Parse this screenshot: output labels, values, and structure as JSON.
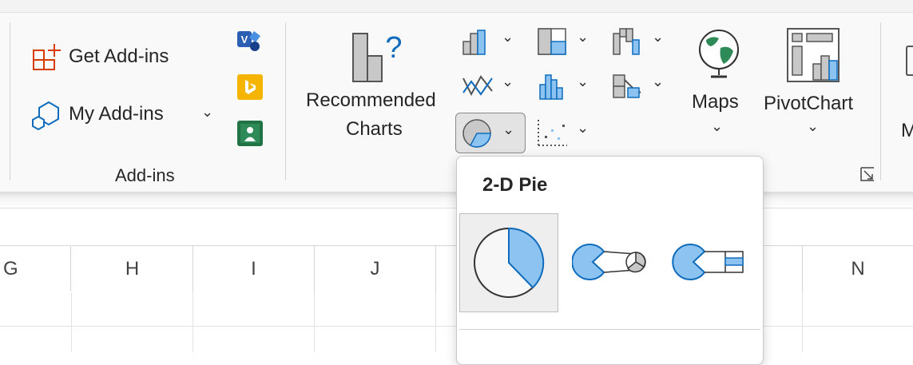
{
  "ribbon": {
    "addins_group": {
      "get_addins_label": "Get Add-ins",
      "my_addins_label": "My Add-ins",
      "group_label": "Add-ins"
    },
    "charts_group": {
      "recommended_line1": "Recommended",
      "recommended_line2": "Charts",
      "maps_label": "Maps",
      "pivotchart_label": "PivotChart",
      "next_group_partial": "M"
    }
  },
  "pie_dropdown": {
    "section_title": "2-D Pie",
    "items": [
      "pie",
      "pie-of-pie",
      "bar-of-pie"
    ]
  },
  "sheet": {
    "columns": [
      "G",
      "H",
      "I",
      "J",
      "N"
    ]
  },
  "colors": {
    "accent_blue": "#0f6cbd",
    "light_blue": "#8cc3f0",
    "excel_green": "#217346",
    "addin_orange": "#d83b01",
    "bing_yellow": "#f4b400"
  }
}
